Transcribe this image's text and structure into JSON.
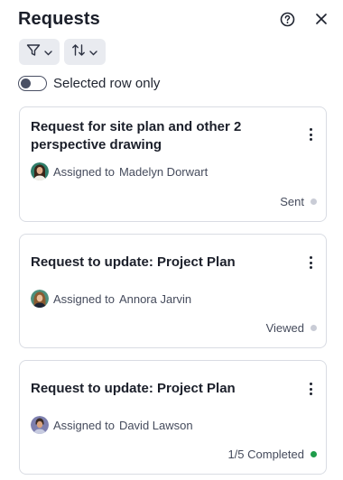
{
  "panel": {
    "title": "Requests"
  },
  "header": {
    "help_icon": "help-circle-icon",
    "close_icon": "close-icon"
  },
  "toolbar": {
    "filter_icon": "filter-icon",
    "sort_icon": "sort-icon"
  },
  "toggle": {
    "label": "Selected row only",
    "checked": false
  },
  "requests": [
    {
      "title": "Request for site plan and other 2 perspective drawing",
      "assigned_prefix": "Assigned to",
      "assignee": "Madelyn Dorwart",
      "status": "Sent",
      "status_color": "#c9ccd6"
    },
    {
      "title": "Request to update: Project Plan",
      "assigned_prefix": "Assigned to",
      "assignee": "Annora Jarvin",
      "status": "Viewed",
      "status_color": "#c9ccd6"
    },
    {
      "title": "Request to update: Project Plan",
      "assigned_prefix": "Assigned to",
      "assignee": "David Lawson",
      "status": "1/5 Completed",
      "status_color": "#1e9c4a"
    }
  ]
}
